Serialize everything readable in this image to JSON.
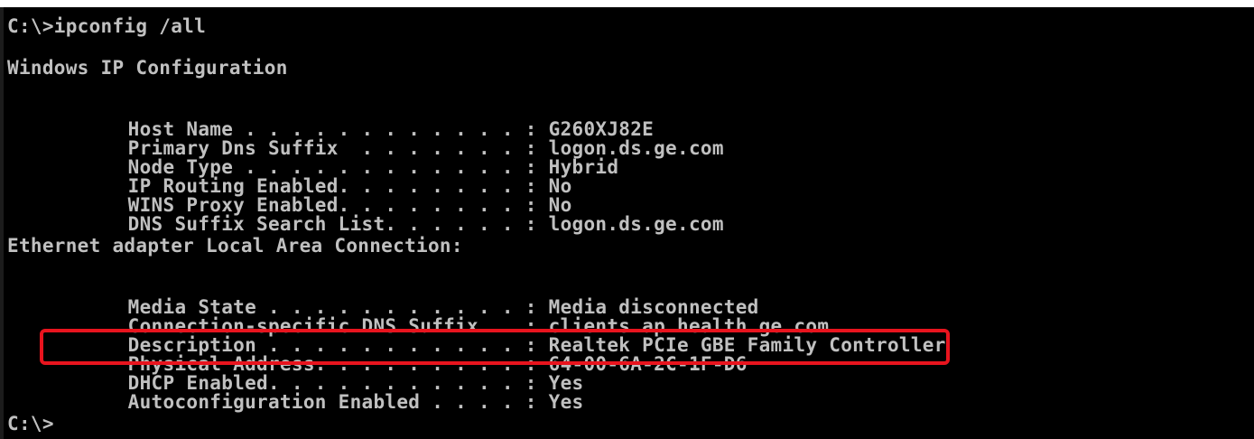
{
  "terminal": {
    "prompt_command": "C:\\>ipconfig /all",
    "section_windows": "Windows IP Configuration",
    "windows_ip": [
      {
        "label": "Host Name . . . . . . . . . . . . :",
        "value": " G260XJ82E"
      },
      {
        "label": "Primary Dns Suffix  . . . . . . . :",
        "value": " logon.ds.ge.com"
      },
      {
        "label": "Node Type . . . . . . . . . . . . :",
        "value": " Hybrid"
      },
      {
        "label": "IP Routing Enabled. . . . . . . . :",
        "value": " No"
      },
      {
        "label": "WINS Proxy Enabled. . . . . . . . :",
        "value": " No"
      },
      {
        "label": "DNS Suffix Search List. . . . . . :",
        "value": " logon.ds.ge.com"
      }
    ],
    "section_ethernet": "Ethernet adapter Local Area Connection:",
    "ethernet": [
      {
        "label": "Media State . . . . . . . . . . . :",
        "value": " Media disconnected"
      },
      {
        "label": "Connection-specific DNS Suffix  . :",
        "value": " clients.ap.health.ge.com"
      },
      {
        "label": "Description . . . . . . . . . . . :",
        "value": " Realtek PCIe GBE Family Controller"
      },
      {
        "label": "Physical Address. . . . . . . . . :",
        "value": " 64-00-6A-2C-1F-D6"
      },
      {
        "label": "DHCP Enabled. . . . . . . . . . . :",
        "value": " Yes"
      },
      {
        "label": "Autoconfiguration Enabled . . . . :",
        "value": " Yes"
      }
    ],
    "final_prompt": "C:\\>"
  },
  "colors": {
    "background": "#000000",
    "text": "#c0c0c0",
    "highlight_border": "#e8141e"
  }
}
